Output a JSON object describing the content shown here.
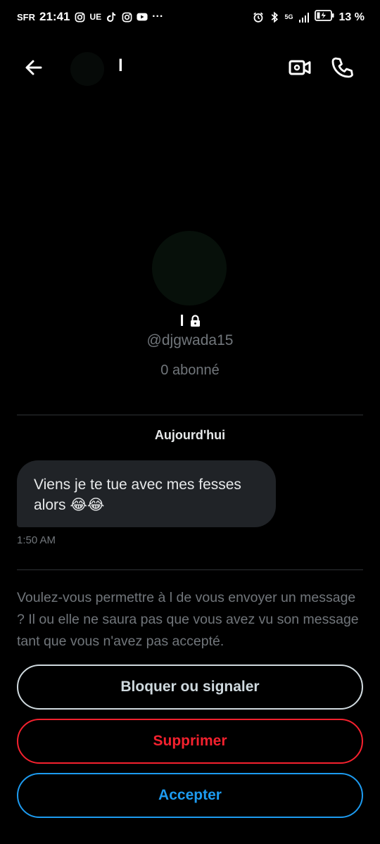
{
  "status_bar": {
    "carrier": "SFR",
    "time": "21:41",
    "ue_label": "UE",
    "more": "···",
    "network": "5G",
    "battery": "13 %"
  },
  "header": {
    "name": "l"
  },
  "profile": {
    "name": "l",
    "handle": "@djgwada15",
    "followers": "0 abonné"
  },
  "conversation": {
    "date": "Aujourd'hui",
    "messages": [
      {
        "text": "Viens je te tue avec mes fesses alors 😂😂",
        "time": "1:50 AM"
      }
    ]
  },
  "request": {
    "prompt": "Voulez-vous permettre à l de vous envoyer un message ? Il ou elle ne saura pas que vous avez vu son message tant que vous n'avez pas accepté.",
    "block_label": "Bloquer ou signaler",
    "delete_label": "Supprimer",
    "accept_label": "Accepter"
  },
  "icons": {
    "back": "arrow-left-icon",
    "video": "video-camera-icon",
    "call": "phone-icon",
    "lock": "lock-icon"
  },
  "colors": {
    "background": "#000000",
    "bubble": "#202327",
    "secondary_text": "#71767b",
    "danger": "#f4212e",
    "accent": "#1d9bf0"
  }
}
